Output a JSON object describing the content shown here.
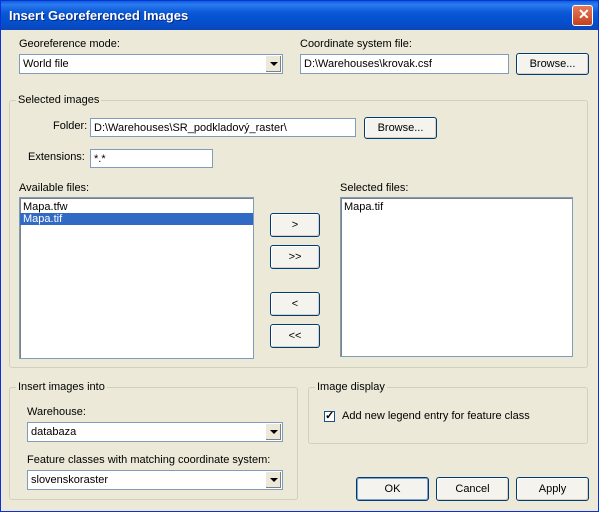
{
  "window": {
    "title": "Insert Georeferenced Images"
  },
  "georeference_mode": {
    "label": "Georeference mode:",
    "value": "World file"
  },
  "coordinate_system_file": {
    "label": "Coordinate system file:",
    "value": "D:\\Warehouses\\krovak.csf",
    "browse_label": "Browse..."
  },
  "selected_images": {
    "group_title": "Selected images",
    "folder_label": "Folder:",
    "folder_value": "D:\\Warehouses\\SR_podkladový_raster\\",
    "browse_label": "Browse...",
    "extensions_label": "Extensions:",
    "extensions_value": "*.*",
    "available_label": "Available files:",
    "available_files": [
      "Mapa.tfw",
      "Mapa.tif"
    ],
    "available_selected_index": 1,
    "selected_label": "Selected files:",
    "selected_files": [
      "Mapa.tif"
    ],
    "move_buttons": {
      "add": ">",
      "add_all": ">>",
      "remove": "<",
      "remove_all": "<<"
    }
  },
  "insert_into": {
    "group_title": "Insert images into",
    "warehouse_label": "Warehouse:",
    "warehouse_value": "databaza",
    "feature_classes_label": "Feature classes with matching coordinate system:",
    "feature_class_value": "slovenskoraster"
  },
  "image_display": {
    "group_title": "Image display",
    "legend_checkbox_label": "Add new legend entry for feature class",
    "legend_checked": true
  },
  "footer": {
    "ok_label": "OK",
    "cancel_label": "Cancel",
    "apply_label": "Apply"
  }
}
